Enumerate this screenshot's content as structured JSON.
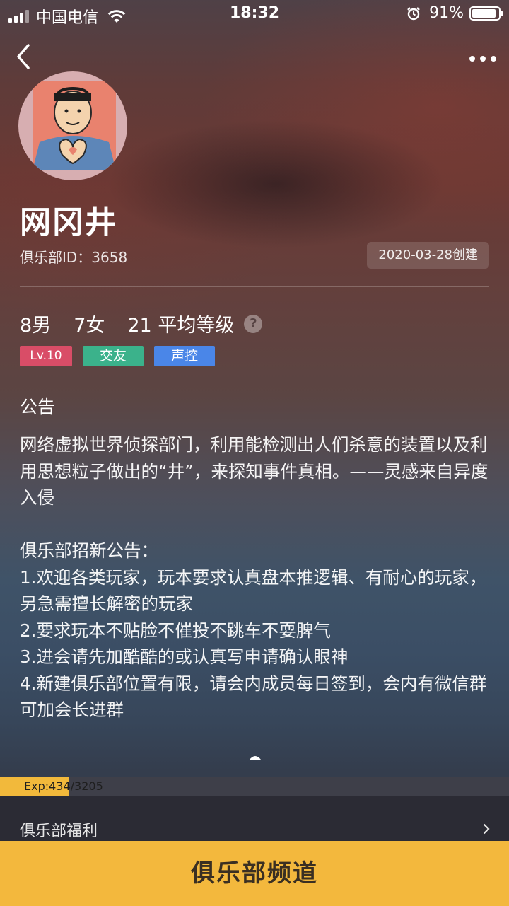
{
  "status_bar": {
    "carrier": "中国电信",
    "time": "18:32",
    "battery_percent": "91%",
    "battery_level": 0.91,
    "icons": [
      "signal-icon",
      "wifi-icon",
      "alarm-icon",
      "battery-icon"
    ]
  },
  "nav": {
    "back_icon": "chevron-left-icon",
    "more_icon": "more-dots-icon"
  },
  "club": {
    "name": "网冈井",
    "id_text": "俱乐部ID：3658",
    "created": "2020-03-28创建",
    "stats": {
      "male": "8男",
      "female": "7女",
      "avg_level": "21 平均等级"
    },
    "help_icon": "?",
    "tags": {
      "level": "Lv.10",
      "friend": "交友",
      "voice": "声控"
    },
    "tag_colors": {
      "level": "#d94d67",
      "friend": "#3bb28b",
      "voice": "#4a86e8"
    }
  },
  "notice": {
    "title": "公告",
    "paragraph1": "网络虚拟世界侦探部门，利用能检测出人们杀意的装置以及利用思想粒子做出的“井”，来探知事件真相。——灵感来自异度入侵",
    "recruit_title": "俱乐部招新公告：",
    "rules": [
      "1.欢迎各类玩家，玩本要求认真盘本推逻辑、有耐心的玩家，另急需擅长解密的玩家",
      "2.要求玩本不贴脸不催投不跳车不耍脾气",
      "3.进会请先加酷酷的或认真写申请确认眼神",
      "4.新建俱乐部位置有限，请会内成员每日签到，会内有微信群可加会长进群"
    ]
  },
  "exp": {
    "text": "Exp:434/3205",
    "current": 434,
    "max": 3205,
    "fill_color": "#f2b93b"
  },
  "welfare": {
    "label": "俱乐部福利"
  },
  "bottom_button": {
    "label": "俱乐部频道",
    "color": "#f3b83d"
  }
}
